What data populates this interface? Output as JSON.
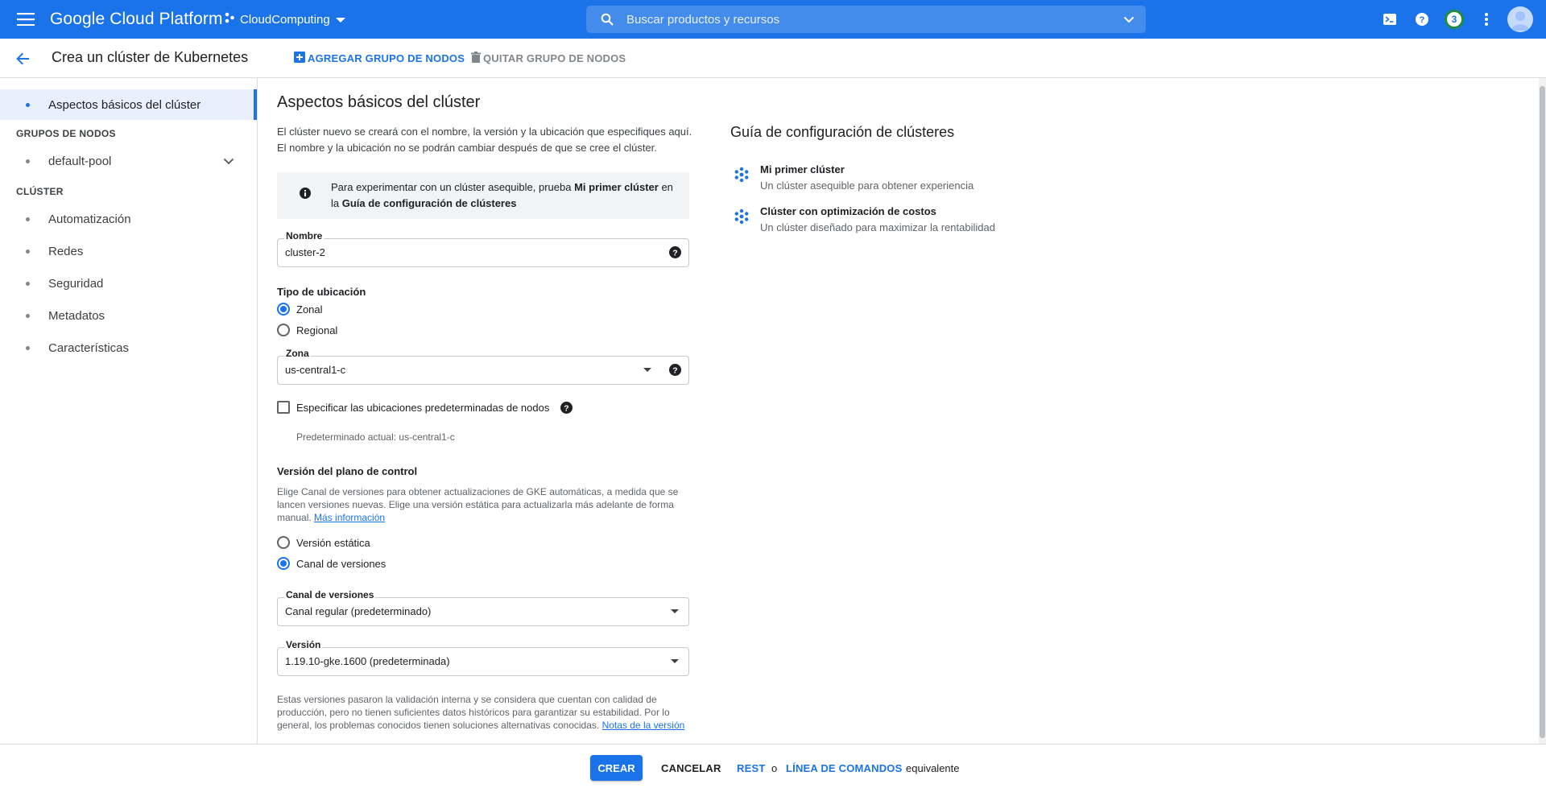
{
  "colors": {
    "brand": "#1a73e8",
    "badge_ring": "#1e8e3e"
  },
  "topbar": {
    "brand": "Google Cloud Platform",
    "project": "CloudComputing",
    "search_placeholder": "Buscar productos y recursos",
    "notifications_count": "3"
  },
  "subbar": {
    "title": "Crea un clúster de Kubernetes",
    "add_node_pool": "AGREGAR GRUPO DE NODOS",
    "remove_node_pool": "QUITAR GRUPO DE NODOS"
  },
  "sidebar": {
    "active_item": "Aspectos básicos del clúster",
    "node_groups_header": "GRUPOS DE NODOS",
    "node_pool": "default-pool",
    "cluster_header": "CLÚSTER",
    "cluster_items": [
      "Automatización",
      "Redes",
      "Seguridad",
      "Metadatos",
      "Características"
    ]
  },
  "main": {
    "title": "Aspectos básicos del clúster",
    "intro_1": "El clúster nuevo se creará con el nombre, la versión y la ubicación que especifiques aquí.",
    "intro_2": "El nombre y la ubicación no se podrán cambiar después de que se cree el clúster.",
    "info_pre": "Para experimentar con un clúster asequible, prueba ",
    "info_bold_1": "Mi primer clúster",
    "info_mid": " en la ",
    "info_bold_2": "Guía de configuración de clústeres",
    "name_label": "Nombre",
    "name_value": "cluster-2",
    "location_type_title": "Tipo de ubicación",
    "radio_zonal": "Zonal",
    "radio_regional": "Regional",
    "zone_label": "Zona",
    "zone_value": "us-central1-c",
    "checkbox_label": "Especificar las ubicaciones predeterminadas de nodos",
    "default_hint": "Predeterminado actual: us-central1-c",
    "control_plane_title": "Versión del plano de control",
    "control_plane_desc": "Elige Canal de versiones para obtener actualizaciones de GKE automáticas, a medida que se lancen versiones nuevas. Elige una versión estática para actualizarla más adelante de forma manual. ",
    "more_info_link": "Más información",
    "radio_static": "Versión estática",
    "radio_channel": "Canal de versiones",
    "channel_label": "Canal de versiones",
    "channel_value": "Canal regular (predeterminado)",
    "version_label": "Versión",
    "version_value": "1.19.10-gke.1600 (predeterminada)",
    "versions_desc": "Estas versiones pasaron la validación interna y se considera que cuentan con calidad de producción, pero no tienen suficientes datos históricos para garantizar su estabilidad. Por lo general, los problemas conocidos tienen soluciones alternativas conocidas. ",
    "release_notes_link": "Notas de la versión"
  },
  "guide": {
    "title": "Guía de configuración de clústeres",
    "items": [
      {
        "title": "Mi primer clúster",
        "subtitle": "Un clúster asequible para obtener experiencia"
      },
      {
        "title": "Clúster con optimización de costos",
        "subtitle": "Un clúster diseñado para maximizar la rentabilidad"
      }
    ]
  },
  "footer": {
    "create": "CREAR",
    "cancel": "CANCELAR",
    "rest": "REST",
    "or": "o",
    "command_line": "LÍNEA DE COMANDOS",
    "equivalent": "equivalente"
  }
}
